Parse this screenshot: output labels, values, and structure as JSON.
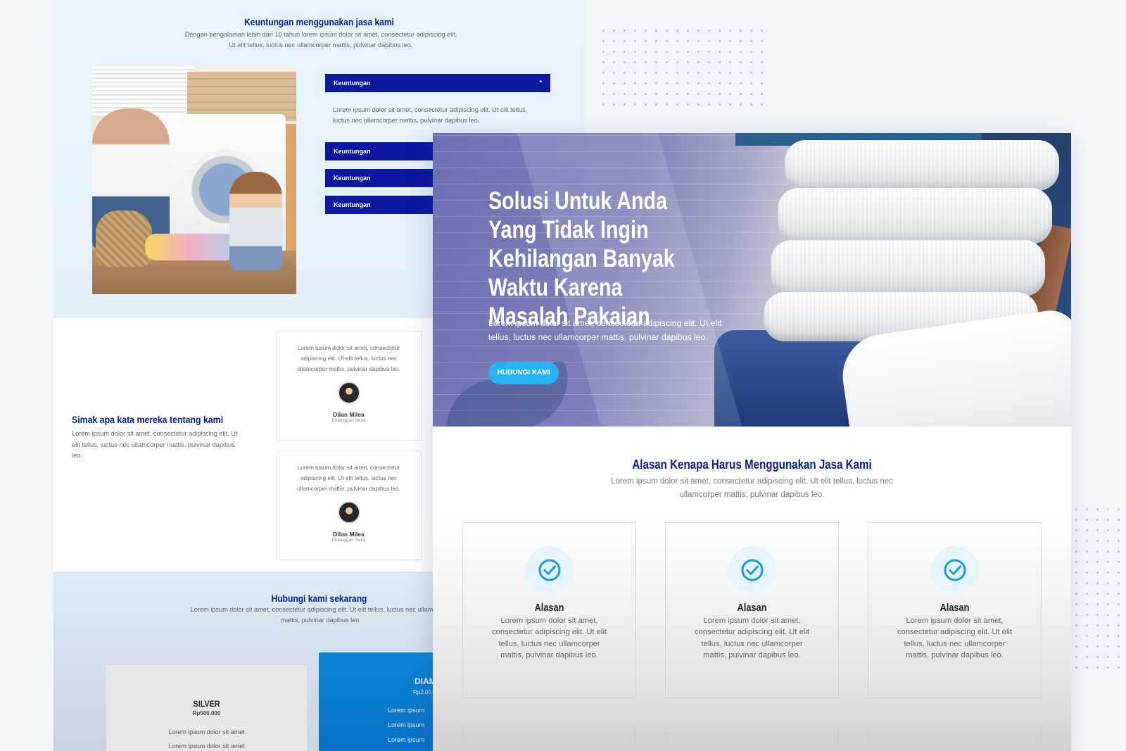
{
  "back_page": {
    "advantages": {
      "title": "Keuntungan menggunakan jasa kami",
      "subtitle": "Dengan pengalaman lebih dari 10 tahun lorem ipsum dolor sit amet, consectetur adipiscing elit. Ut elit tellus, luctus nec ullamcorper mattis, pulvinar dapibus leo.",
      "accordion": [
        {
          "label": "Keuntungan",
          "open": true,
          "body": "Lorem ipsum dolor sit amet, consectetur adipiscing elit. Ut elit tellus, luctus nec ullamcorper mattis, pulvinar dapibus leo."
        },
        {
          "label": "Keuntungan",
          "open": false
        },
        {
          "label": "Keuntungan",
          "open": false
        },
        {
          "label": "Keuntungan",
          "open": false
        }
      ]
    },
    "testimonials": {
      "title": "Simak apa kata mereka tentang kami",
      "text": "Lorem ipsum dolor sit amet, consectetur adipiscing elit. Ut elit tellus, luctus nec ullamcorper mattis, pulvinar dapibus leo.",
      "cards": [
        {
          "quote": "Lorem ipsum dolor sit amet, consectetur adipiscing elit. Ut elit tellus, luctus nec ullamcorper mattis, pulvinar dapibus leo.",
          "name": "Dilan Milea",
          "role": "Pelanggan Setia"
        },
        {
          "quote": "Lorem ipsum dolor sit amet, consectetur adipiscing elit. Ut elit tellus, luctus nec ullamcorper mattis, pulvinar dapibus leo.",
          "name": "Dilan Milea",
          "role": "Pelanggan Setia"
        }
      ]
    },
    "contact": {
      "title": "Hubungi kami sekarang",
      "subtitle": "Lorem ipsum dolor sit amet, consectetur adipiscing elit. Ut elit tellus, luctus nec ullamcorper mattis, pulvinar dapibus leo.",
      "plans": [
        {
          "name": "SILVER",
          "price": "Rp500.000",
          "features": [
            "Lorem ipsum dolor sit amet",
            "Lorem ipsum dolor sit amet"
          ]
        },
        {
          "name": "DIAM",
          "price": "Rp2.00",
          "features": [
            "Lorem ipsum",
            "Lorem ipsum",
            "Lorem ipsum"
          ]
        }
      ]
    }
  },
  "front_page": {
    "hero": {
      "title": "Solusi Untuk Anda Yang Tidak Ingin Kehilangan Banyak Waktu Karena Masalah Pakaian",
      "text": "Lorem ipsum dolor sit amet, consectetur adipiscing elit. Ut elit tellus, luctus nec ullamcorper mattis, pulvinar dapibus leo.",
      "button": "HUBUNGI KAMI"
    },
    "reasons": {
      "title": "Alasan Kenapa Harus Menggunakan Jasa Kami",
      "subtitle": "Lorem ipsum dolor sit amet, consectetur adipiscing elit. Ut elit tellus, luctus nec ullamcorper mattis, pulvinar dapibus leo.",
      "cards": [
        {
          "icon": "check-circle-icon",
          "title": "Alasan",
          "text": "Lorem ipsum dolor sit amet, consectetur adipiscing elit. Ut elit tellus, luctus nec ullamcorper mattis, pulvinar dapibus leo."
        },
        {
          "icon": "check-circle-icon",
          "title": "Alasan",
          "text": "Lorem ipsum dolor sit amet, consectetur adipiscing elit. Ut elit tellus, luctus nec ullamcorper mattis, pulvinar dapibus leo."
        },
        {
          "icon": "check-circle-icon",
          "title": "Alasan",
          "text": "Lorem ipsum dolor sit amet, consectetur adipiscing elit. Ut elit tellus, luctus nec ullamcorper mattis, pulvinar dapibus leo."
        }
      ]
    }
  },
  "colors": {
    "brand_navy": "#0a1b8f",
    "accordion_blue": "#0d189f",
    "cta_blue": "#27b2f4",
    "icon_blue": "#1d9be0"
  }
}
